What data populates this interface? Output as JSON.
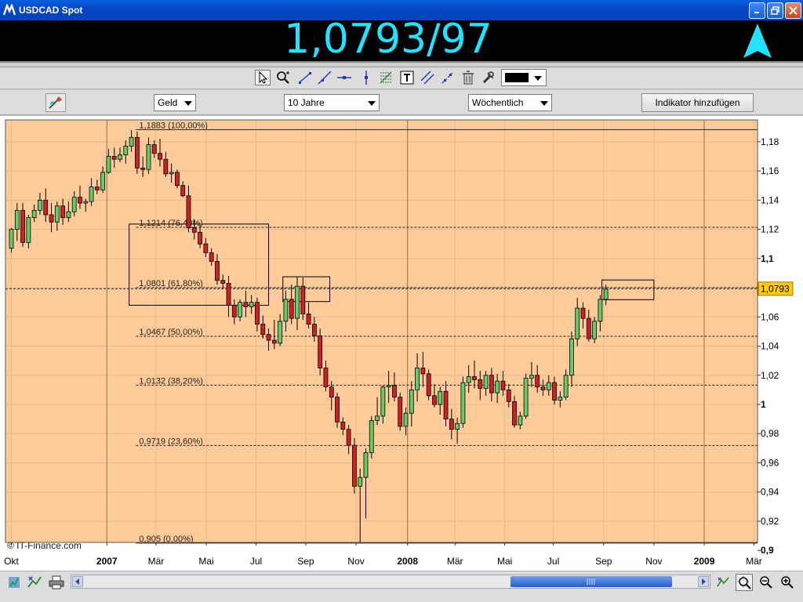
{
  "window": {
    "title": "USDCAD Spot"
  },
  "quote": {
    "value": "1,0793/97",
    "direction": "up",
    "color": "#22e3ff"
  },
  "controls": {
    "price_type": "Geld",
    "period": "10 Jahre",
    "interval": "Wöchentlich",
    "add_indicator_label": "Indikator hinzufügen"
  },
  "toolbar": {
    "icons": [
      "cursor-icon",
      "zoom-icon",
      "trendline-icon",
      "ray-icon",
      "horizontal-line-icon",
      "vertical-line-icon",
      "fibonacci-icon",
      "text-icon",
      "parallel-channel-icon",
      "extend-line-icon",
      "trash-icon",
      "settings-icon"
    ],
    "line_color": "#000000"
  },
  "chart_data": {
    "type": "candlestick",
    "instrument": "USDCAD",
    "watermark": "© IT-Finance.com",
    "y_axis": {
      "min": 0.9,
      "max": 1.19,
      "ticks": [
        "1,18",
        "1,16",
        "1,14",
        "1,12",
        "1,1",
        "1,08",
        "1,06",
        "1,04",
        "1,02",
        "1",
        "0,98",
        "0,96",
        "0,94",
        "0,92",
        "0,9"
      ],
      "tick_values": [
        1.18,
        1.16,
        1.14,
        1.12,
        1.1,
        1.08,
        1.06,
        1.04,
        1.02,
        1.0,
        0.98,
        0.96,
        0.94,
        0.92,
        0.9
      ],
      "bold_values": [
        1.1,
        1.0,
        0.9
      ]
    },
    "x_axis": {
      "labels": [
        "Okt",
        "2007",
        "Mär",
        "Mai",
        "Jul",
        "Sep",
        "Nov",
        "2008",
        "Mär",
        "Mai",
        "Jul",
        "Sep",
        "Nov",
        "2009",
        "Mär"
      ],
      "label_weeks": [
        0,
        16.7,
        25.3,
        34.1,
        42.8,
        51.5,
        60.3,
        69.3,
        77.6,
        86.3,
        94.8,
        103.6,
        112.4,
        121.2,
        129.9
      ],
      "bold_labels": [
        "2007",
        "2008",
        "2009"
      ],
      "year_line_weeks": [
        16.7,
        69.3,
        121.2
      ]
    },
    "current_price": {
      "label": "1,0793",
      "value": 1.0793
    },
    "fibonacci": [
      {
        "label": "1,1883 (100,00%)",
        "value": 1.1883
      },
      {
        "label": "1,1214 (76,40%)",
        "value": 1.1214
      },
      {
        "label": "1,0801 (61,80%)",
        "value": 1.0801
      },
      {
        "label": "1,0467 (50,00%)",
        "value": 1.0467
      },
      {
        "label": "1,0132 (38,20%)",
        "value": 1.0132
      },
      {
        "label": "0,9719 (23,60%)",
        "value": 0.9719
      },
      {
        "label": "0,905 (0,00%)",
        "value": 0.905
      }
    ],
    "highlight_boxes": [
      {
        "week_from": 20.6,
        "week_to": 45,
        "value_from": 1.068,
        "value_to": 1.1236
      },
      {
        "week_from": 47.5,
        "week_to": 55.7,
        "value_from": 1.0705,
        "value_to": 1.0875
      },
      {
        "week_from": 103.3,
        "week_to": 112.4,
        "value_from": 1.0718,
        "value_to": 1.0853
      }
    ],
    "candles": [
      [
        1.107,
        1.121,
        1.104,
        1.12
      ],
      [
        1.12,
        1.138,
        1.112,
        1.133
      ],
      [
        1.133,
        1.138,
        1.108,
        1.111
      ],
      [
        1.111,
        1.13,
        1.107,
        1.128
      ],
      [
        1.128,
        1.137,
        1.125,
        1.133
      ],
      [
        1.133,
        1.145,
        1.13,
        1.14
      ],
      [
        1.14,
        1.148,
        1.125,
        1.13
      ],
      [
        1.13,
        1.138,
        1.118,
        1.125
      ],
      [
        1.125,
        1.139,
        1.119,
        1.136
      ],
      [
        1.136,
        1.141,
        1.123,
        1.128
      ],
      [
        1.128,
        1.139,
        1.125,
        1.132
      ],
      [
        1.132,
        1.146,
        1.129,
        1.142
      ],
      [
        1.142,
        1.15,
        1.134,
        1.138
      ],
      [
        1.138,
        1.141,
        1.132,
        1.139
      ],
      [
        1.139,
        1.155,
        1.136,
        1.149
      ],
      [
        1.149,
        1.154,
        1.144,
        1.147
      ],
      [
        1.147,
        1.163,
        1.145,
        1.159
      ],
      [
        1.159,
        1.175,
        1.158,
        1.17
      ],
      [
        1.17,
        1.176,
        1.162,
        1.168
      ],
      [
        1.168,
        1.176,
        1.166,
        1.171
      ],
      [
        1.171,
        1.181,
        1.165,
        1.177
      ],
      [
        1.177,
        1.188,
        1.173,
        1.183
      ],
      [
        1.183,
        1.187,
        1.158,
        1.162
      ],
      [
        1.162,
        1.17,
        1.156,
        1.161
      ],
      [
        1.161,
        1.183,
        1.158,
        1.178
      ],
      [
        1.178,
        1.181,
        1.169,
        1.172
      ],
      [
        1.172,
        1.182,
        1.163,
        1.168
      ],
      [
        1.168,
        1.173,
        1.156,
        1.158
      ],
      [
        1.158,
        1.165,
        1.152,
        1.159
      ],
      [
        1.159,
        1.161,
        1.148,
        1.15
      ],
      [
        1.15,
        1.153,
        1.142,
        1.143
      ],
      [
        1.143,
        1.15,
        1.118,
        1.121
      ],
      [
        1.121,
        1.127,
        1.113,
        1.118
      ],
      [
        1.118,
        1.123,
        1.107,
        1.11
      ],
      [
        1.11,
        1.114,
        1.101,
        1.104
      ],
      [
        1.104,
        1.107,
        1.095,
        1.098
      ],
      [
        1.098,
        1.103,
        1.082,
        1.085
      ],
      [
        1.085,
        1.089,
        1.079,
        1.083
      ],
      [
        1.083,
        1.088,
        1.06,
        1.068
      ],
      [
        1.068,
        1.072,
        1.055,
        1.06
      ],
      [
        1.06,
        1.072,
        1.057,
        1.07
      ],
      [
        1.07,
        1.078,
        1.06,
        1.067
      ],
      [
        1.067,
        1.075,
        1.062,
        1.07
      ],
      [
        1.07,
        1.073,
        1.05,
        1.055
      ],
      [
        1.055,
        1.061,
        1.045,
        1.048
      ],
      [
        1.048,
        1.052,
        1.037,
        1.044
      ],
      [
        1.044,
        1.058,
        1.038,
        1.042
      ],
      [
        1.042,
        1.062,
        1.04,
        1.057
      ],
      [
        1.057,
        1.078,
        1.05,
        1.072
      ],
      [
        1.072,
        1.082,
        1.055,
        1.059
      ],
      [
        1.059,
        1.087,
        1.051,
        1.081
      ],
      [
        1.081,
        1.087,
        1.058,
        1.062
      ],
      [
        1.062,
        1.07,
        1.052,
        1.055
      ],
      [
        1.055,
        1.06,
        1.043,
        1.047
      ],
      [
        1.047,
        1.052,
        1.02,
        1.025
      ],
      [
        1.025,
        1.03,
        1.009,
        1.012
      ],
      [
        1.012,
        1.016,
        0.996,
        1.005
      ],
      [
        1.005,
        1.008,
        0.984,
        0.988
      ],
      [
        0.988,
        0.991,
        0.979,
        0.983
      ],
      [
        0.983,
        0.986,
        0.966,
        0.972
      ],
      [
        0.972,
        0.977,
        0.939,
        0.944
      ],
      [
        0.944,
        0.956,
        0.905,
        0.95
      ],
      [
        0.95,
        0.97,
        0.922,
        0.967
      ],
      [
        0.967,
        0.992,
        0.963,
        0.989
      ],
      [
        0.989,
        1.005,
        0.986,
        0.992
      ],
      [
        0.992,
        1.013,
        0.987,
        1.012
      ],
      [
        1.012,
        1.023,
        1.001,
        1.013
      ],
      [
        1.013,
        1.022,
        1.002,
        1.005
      ],
      [
        1.005,
        1.008,
        0.982,
        0.985
      ],
      [
        0.985,
        0.998,
        0.979,
        0.994
      ],
      [
        0.994,
        1.016,
        0.985,
        1.01
      ],
      [
        1.01,
        1.035,
        1.002,
        1.025
      ],
      [
        1.025,
        1.036,
        1.012,
        1.021
      ],
      [
        1.021,
        1.024,
        1.003,
        1.006
      ],
      [
        1.006,
        1.014,
        0.998,
        1.0
      ],
      [
        1.0,
        1.012,
        0.993,
        1.009
      ],
      [
        1.009,
        1.016,
        0.985,
        0.99
      ],
      [
        0.99,
        0.997,
        0.976,
        0.983
      ],
      [
        0.983,
        0.991,
        0.973,
        0.987
      ],
      [
        0.987,
        1.019,
        0.984,
        1.015
      ],
      [
        1.015,
        1.027,
        1.008,
        1.019
      ],
      [
        1.019,
        1.03,
        1.011,
        1.017
      ],
      [
        1.017,
        1.023,
        1.003,
        1.011
      ],
      [
        1.011,
        1.023,
        1.006,
        1.02
      ],
      [
        1.02,
        1.025,
        1.002,
        1.008
      ],
      [
        1.008,
        1.021,
        1.001,
        1.016
      ],
      [
        1.016,
        1.023,
        1.006,
        1.01
      ],
      [
        1.01,
        1.014,
        0.998,
        1.002
      ],
      [
        1.002,
        1.006,
        0.984,
        0.986
      ],
      [
        0.986,
        0.995,
        0.983,
        0.992
      ],
      [
        0.992,
        1.021,
        0.99,
        1.018
      ],
      [
        1.018,
        1.029,
        1.012,
        1.02
      ],
      [
        1.02,
        1.027,
        1.008,
        1.012
      ],
      [
        1.012,
        1.017,
        1.006,
        1.01
      ],
      [
        1.01,
        1.02,
        1.006,
        1.015
      ],
      [
        1.015,
        1.019,
        1.0,
        1.003
      ],
      [
        1.003,
        1.009,
        0.998,
        1.005
      ],
      [
        1.005,
        1.024,
        1.003,
        1.02
      ],
      [
        1.02,
        1.05,
        1.012,
        1.045
      ],
      [
        1.045,
        1.073,
        1.04,
        1.066
      ],
      [
        1.066,
        1.07,
        1.052,
        1.059
      ],
      [
        1.059,
        1.065,
        1.043,
        1.045
      ],
      [
        1.045,
        1.06,
        1.042,
        1.057
      ],
      [
        1.057,
        1.075,
        1.05,
        1.072
      ],
      [
        1.072,
        1.082,
        1.068,
        1.079
      ]
    ]
  },
  "bottom_toolbar": {
    "icons": [
      "settings-wheel-icon",
      "compare-icon",
      "print-icon",
      "crosshair-zoom-icon",
      "zoom-out-icon",
      "zoom-in-icon",
      "auto-scale-icon"
    ]
  }
}
